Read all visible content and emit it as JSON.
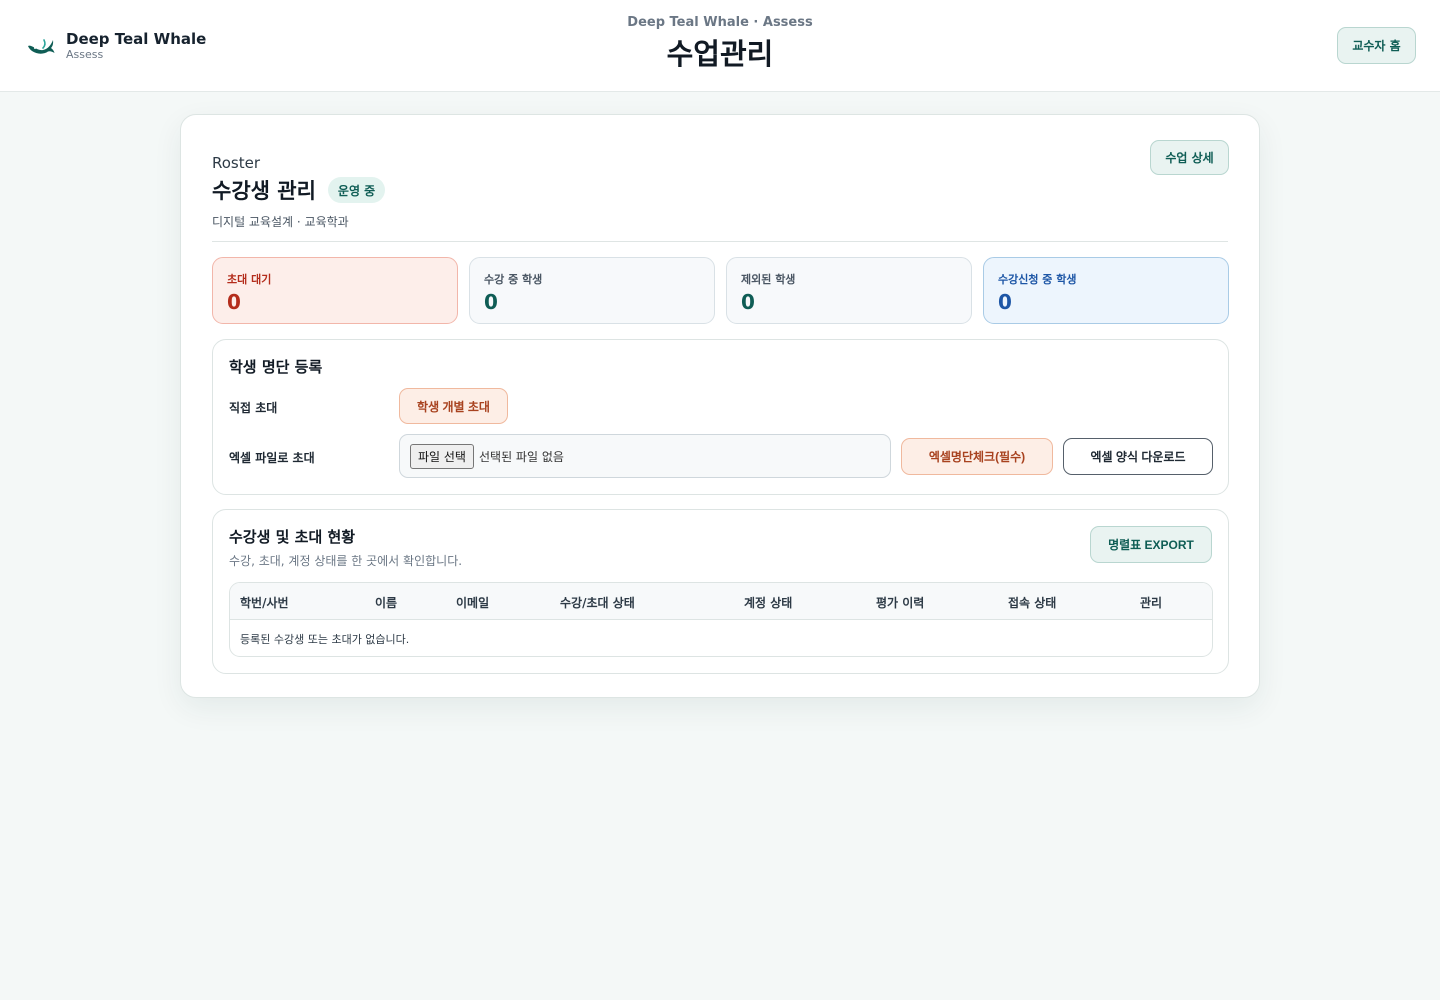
{
  "header": {
    "brand_name": "Deep Teal Whale",
    "brand_sub": "Assess",
    "eyebrow": "Deep Teal Whale · Assess",
    "title": "수업관리",
    "home_button": "교수자 홈"
  },
  "roster": {
    "eyebrow": "Roster",
    "title": "수강생 관리",
    "status_badge": "운영 중",
    "subtitle": "디지털 교육설계 · 교육학과",
    "detail_button": "수업 상세"
  },
  "stats": [
    {
      "label": "초대 대기",
      "value": "0"
    },
    {
      "label": "수강 중 학생",
      "value": "0"
    },
    {
      "label": "제외된 학생",
      "value": "0"
    },
    {
      "label": "수강신청 중 학생",
      "value": "0"
    }
  ],
  "register": {
    "title": "학생 명단 등록",
    "direct_label": "직접 초대",
    "invite_button": "학생 개별 초대",
    "excel_label": "엑셀 파일로 초대",
    "file_choose": "파일 선택",
    "file_none": "선택된 파일 없음",
    "check_button": "엑셀명단체크(필수)",
    "download_button": "엑셀 양식 다운로드"
  },
  "status": {
    "title": "수강생 및 초대 현황",
    "description": "수강, 초대, 계정 상태를 한 곳에서 확인합니다.",
    "export_button": "명렬표 EXPORT",
    "columns": [
      "학번/사번",
      "이름",
      "이메일",
      "수강/초대 상태",
      "계정 상태",
      "평가 이력",
      "접속 상태",
      "관리"
    ],
    "empty_text": "등록된 수강생 또는 초대가 없습니다."
  },
  "colors": {
    "accent": "#0f5d55",
    "pending": "#b42d1c",
    "apply": "#1d56a6",
    "warm": "#a8421f"
  }
}
